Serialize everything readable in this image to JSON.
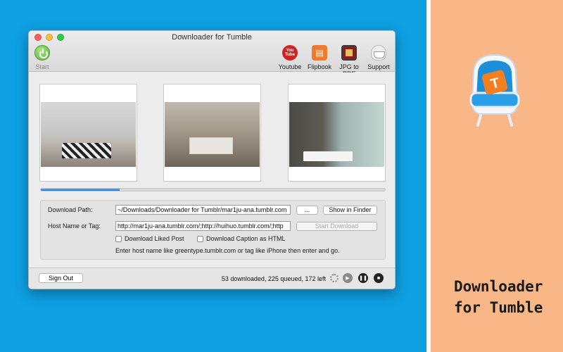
{
  "window": {
    "title": "Downloader for Tumble"
  },
  "toolbar": {
    "start_label": "Start",
    "items": [
      {
        "label": "Youtube",
        "icon": "youtube-icon",
        "badge": "You Tube"
      },
      {
        "label": "Flipbook",
        "icon": "flipbook-icon"
      },
      {
        "label": "JPG to PDF",
        "icon": "jpg-to-pdf-icon"
      },
      {
        "label": "Support",
        "icon": "support-icon"
      }
    ]
  },
  "progress": {
    "fraction": 0.23
  },
  "form": {
    "download_path_label": "Download Path:",
    "download_path_value": "~/Downloads/Downloader for Tumblr/mar1ju-ana.tumblr.com",
    "browse_label": "...",
    "show_in_finder_label": "Show in Finder",
    "host_label": "Host Name or Tag:",
    "host_value": "http://mar1ju-ana.tumblr.com/;http://huihuo.tumblr.com/;http",
    "start_download_label": "Start Download",
    "download_liked_label": "Download Liked Post",
    "download_caption_label": "Download Caption as HTML",
    "hint": "Enter host name like greentype.tumblr.com or tag like iPhone then enter and go."
  },
  "bottom": {
    "signout_label": "Sign Out",
    "status": "53 downloaded, 225 queued, 172 left"
  },
  "promo": {
    "line1": "Downloader",
    "line2": "for Tumble",
    "mascot_letter": "T"
  },
  "colors": {
    "background_blue": "#0ea0e3",
    "background_peach": "#f9b687",
    "progress": "#2c7fd8",
    "brand_orange": "#f47f20"
  }
}
